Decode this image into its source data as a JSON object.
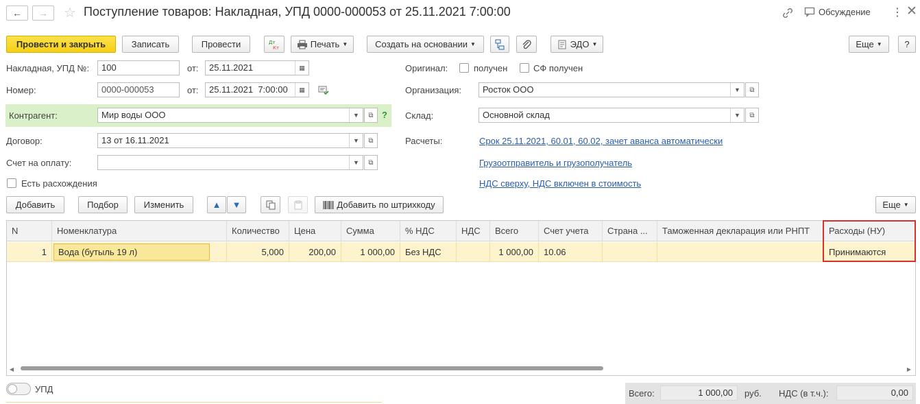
{
  "header": {
    "title": "Поступление товаров: Накладная, УПД 0000-000053 от 25.11.2021 7:00:00",
    "discuss_label": "Обсуждение"
  },
  "toolbar": {
    "post_close": "Провести и закрыть",
    "save": "Записать",
    "post": "Провести",
    "dt_kt": "Дт Кт",
    "print": "Печать",
    "create_based": "Создать на основании",
    "edo": "ЭДО",
    "more": "Еще"
  },
  "form": {
    "invoice_label": "Накладная, УПД №:",
    "invoice_value": "100",
    "from_label": "от:",
    "invoice_date": "25.11.2021",
    "number_label": "Номер:",
    "number_value": "0000-000053",
    "number_from_label": "от:",
    "number_date": "25.11.2021  7:00:00",
    "counterparty_label": "Контрагент:",
    "counterparty_value": "Мир воды ООО",
    "help_mark": "?",
    "contract_label": "Договор:",
    "contract_value": "13 от 16.11.2021",
    "payment_label": "Счет на оплату:",
    "payment_value": "",
    "discrepancy_label": "Есть расхождения",
    "original_label": "Оригинал:",
    "received_label": "получен",
    "sf_received_label": "СФ получен",
    "org_label": "Организация:",
    "org_value": "Росток ООО",
    "warehouse_label": "Склад:",
    "warehouse_value": "Основной склад",
    "settlements_label": "Расчеты:",
    "settlements_link": "Срок 25.11.2021, 60.01, 60.02, зачет аванса автоматически",
    "shipper_link": "Грузоотправитель и грузополучатель",
    "vat_link": "НДС сверху, НДС включен в стоимость"
  },
  "table_toolbar": {
    "add": "Добавить",
    "pick": "Подбор",
    "edit": "Изменить",
    "barcode": "Добавить по штрихкоду",
    "more": "Еще"
  },
  "table": {
    "columns": [
      "N",
      "Номенклатура",
      "Количество",
      "Цена",
      "Сумма",
      "% НДС",
      "НДС",
      "Всего",
      "Счет учета",
      "Страна ...",
      "Таможенная декларация или РНПТ",
      "Расходы (НУ)"
    ],
    "rows": [
      [
        "1",
        "Вода (бутыль 19 л)",
        "5,000",
        "200,00",
        "1 000,00",
        "Без НДС",
        "",
        "1 000,00",
        "10.06",
        "",
        "",
        "Принимаются"
      ]
    ]
  },
  "footer": {
    "upd_label": "УПД",
    "total_label": "Всего:",
    "total_value": "1 000,00",
    "currency": "руб.",
    "vat_label": "НДС (в т.ч.):",
    "vat_value": "0,00"
  },
  "colors": {
    "primary_button": "#f5d016",
    "counterparty_highlight": "#d9f0c9",
    "selected_row": "#fdf3cc",
    "highlight_border": "#d9302c",
    "link": "#2b5dab"
  }
}
